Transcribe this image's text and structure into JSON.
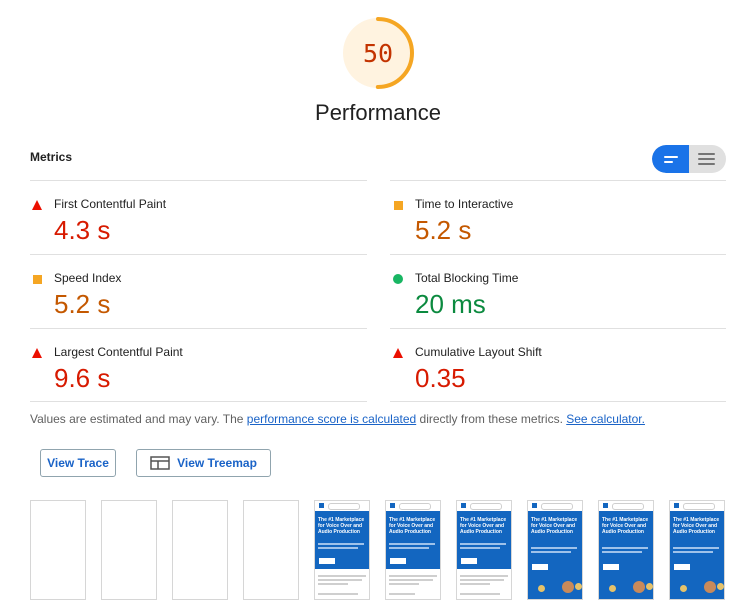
{
  "gauge": {
    "score": "50",
    "fraction": 0.5,
    "color": "#f5a623"
  },
  "category": {
    "title": "Performance"
  },
  "metrics_section": {
    "label": "Metrics"
  },
  "metrics": [
    {
      "name": "First Contentful Paint",
      "value": "4.3 s",
      "status": "fail",
      "color": "#d71a00"
    },
    {
      "name": "Time to Interactive",
      "value": "5.2 s",
      "status": "average",
      "color": "#c45800"
    },
    {
      "name": "Speed Index",
      "value": "5.2 s",
      "status": "average",
      "color": "#c45800"
    },
    {
      "name": "Total Blocking Time",
      "value": "20 ms",
      "status": "pass",
      "color": "#0b8a3f"
    },
    {
      "name": "Largest Contentful Paint",
      "value": "9.6 s",
      "status": "fail",
      "color": "#d71a00"
    },
    {
      "name": "Cumulative Layout Shift",
      "value": "0.35",
      "status": "fail",
      "color": "#d71a00"
    }
  ],
  "note": {
    "prefix": "Values are estimated and may vary. The ",
    "link1": "performance score is calculated",
    "middle": " directly from these metrics. ",
    "link2": "See calculator."
  },
  "buttons": {
    "view_trace": "View Trace",
    "view_treemap": "View Treemap"
  },
  "filmstrip": {
    "headline_a": "The #1 Marketplace for Voice Over and Audio Production",
    "headline_b": "The #1 Marketplace for Voice Over and Audio Production"
  },
  "icons": {
    "toggle_left": "bars-compact-icon",
    "toggle_right": "bars-expanded-icon",
    "treemap": "treemap-icon"
  }
}
